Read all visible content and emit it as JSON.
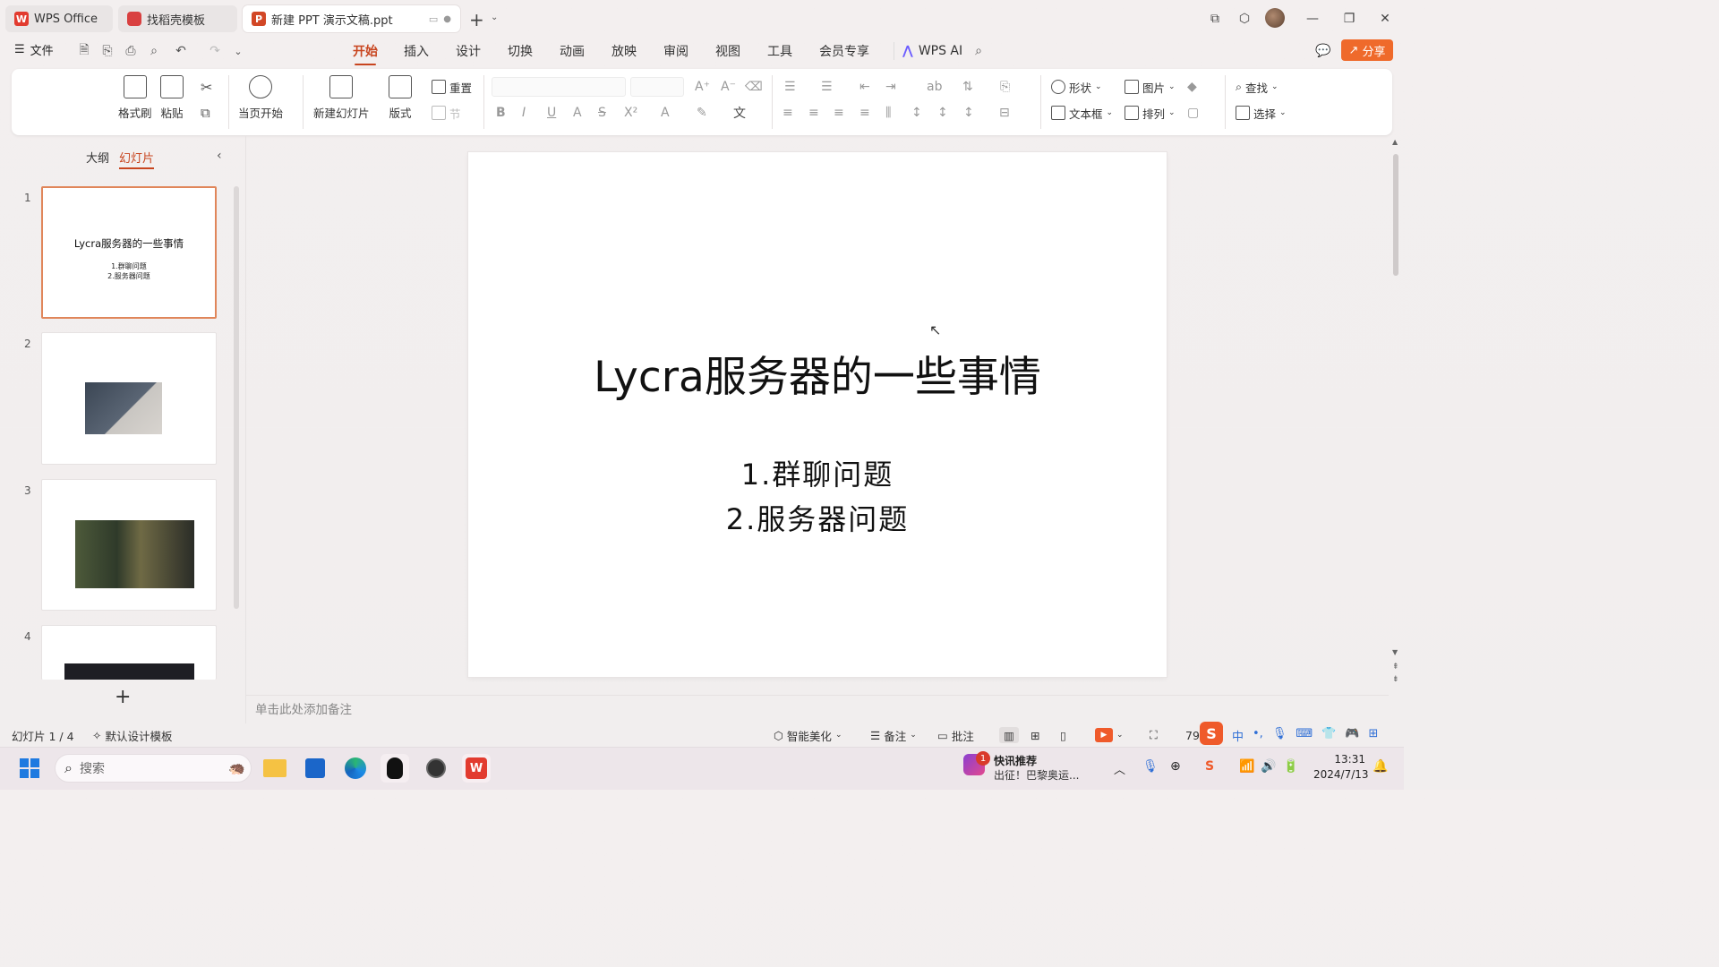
{
  "tabs": [
    {
      "label": "WPS Office"
    },
    {
      "label": "找稻壳模板"
    },
    {
      "label": "新建 PPT 演示文稿.ppt"
    }
  ],
  "menu": {
    "file": "文件",
    "items": [
      "开始",
      "插入",
      "设计",
      "切换",
      "动画",
      "放映",
      "审阅",
      "视图",
      "工具",
      "会员专享"
    ],
    "active": "开始",
    "wps_ai": "WPS AI",
    "share": "分享"
  },
  "ribbon": {
    "format_painter": "格式刷",
    "paste": "粘贴",
    "play_from_current": "当页开始",
    "new_slide": "新建幻灯片",
    "layout": "版式",
    "reset": "重置",
    "section": "节",
    "shape": "形状",
    "picture": "图片",
    "textbox": "文本框",
    "arrange": "排列",
    "find": "查找",
    "select": "选择"
  },
  "left_panel": {
    "tab_outline": "大纲",
    "tab_slides": "幻灯片",
    "slides": [
      {
        "num": "1",
        "title": "Lycra服务器的一些事情",
        "lines": [
          "1.群聊问题",
          "2.服务器问题"
        ]
      },
      {
        "num": "2"
      },
      {
        "num": "3"
      },
      {
        "num": "4"
      }
    ],
    "add_icon": "+"
  },
  "slide": {
    "title": "Lycra服务器的一些事情",
    "line1": "1.群聊问题",
    "line2": "2.服务器问题"
  },
  "notes_placeholder": "单击此处添加备注",
  "statusbar": {
    "slide_counter": "幻灯片 1 / 4",
    "template": "默认设计模板",
    "smart_beautify": "智能美化",
    "notes": "备注",
    "comments": "批注",
    "zoom": "79%"
  },
  "taskbar": {
    "search_placeholder": "搜索",
    "news_title": "快讯推荐",
    "news_sub": "出征！巴黎奥运...",
    "news_badge": "1",
    "time": "13:31",
    "date": "2024/7/13"
  },
  "colors": {
    "accent": "#c8451f",
    "share": "#ef6a2b",
    "selected_border": "#e0865a"
  }
}
